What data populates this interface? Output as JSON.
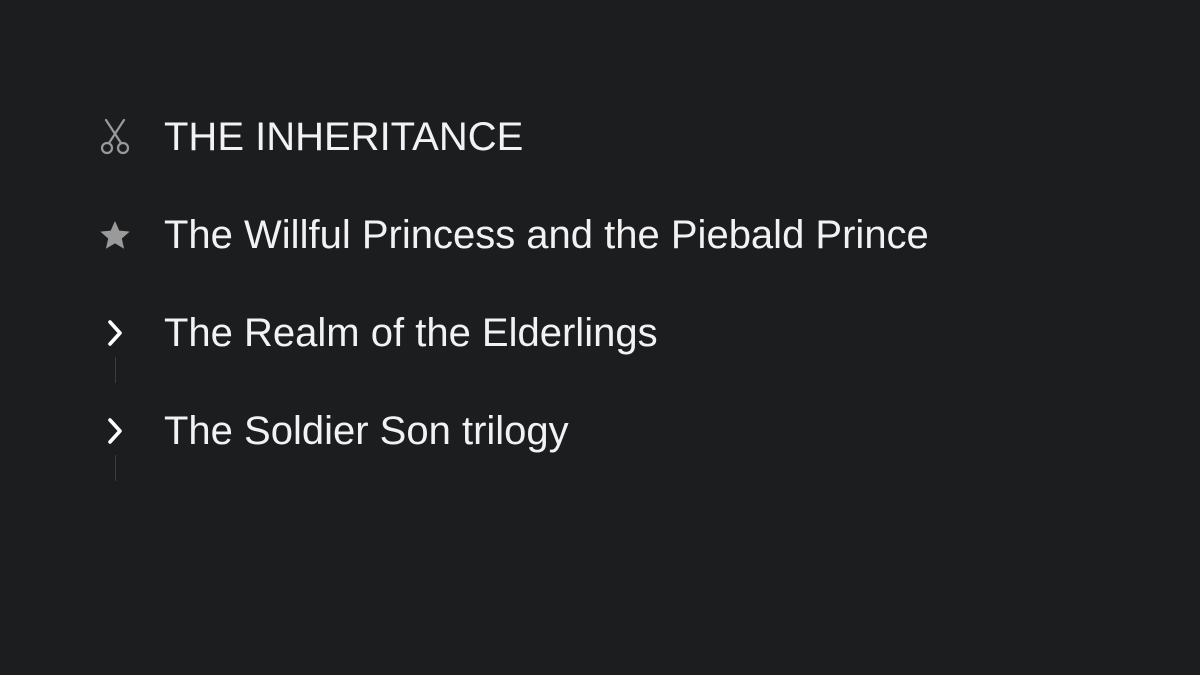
{
  "outline": {
    "items": [
      {
        "label": "THE INHERITANCE",
        "icon": "scissors-icon",
        "icon_color": "#9a9a9a"
      },
      {
        "label": "The Willful Princess and the Piebald Prince",
        "icon": "star-icon",
        "icon_color": "#9a9a9a"
      },
      {
        "label": "The Realm of the Elderlings",
        "icon": "chevron-right-icon",
        "icon_color": "#ffffff"
      },
      {
        "label": "The Soldier Son trilogy",
        "icon": "chevron-right-icon",
        "icon_color": "#ffffff"
      }
    ]
  },
  "colors": {
    "background": "#1c1d1f",
    "text": "#f2f2f2",
    "muted_icon": "#9a9a9a",
    "guide_line": "#3c3d40"
  }
}
